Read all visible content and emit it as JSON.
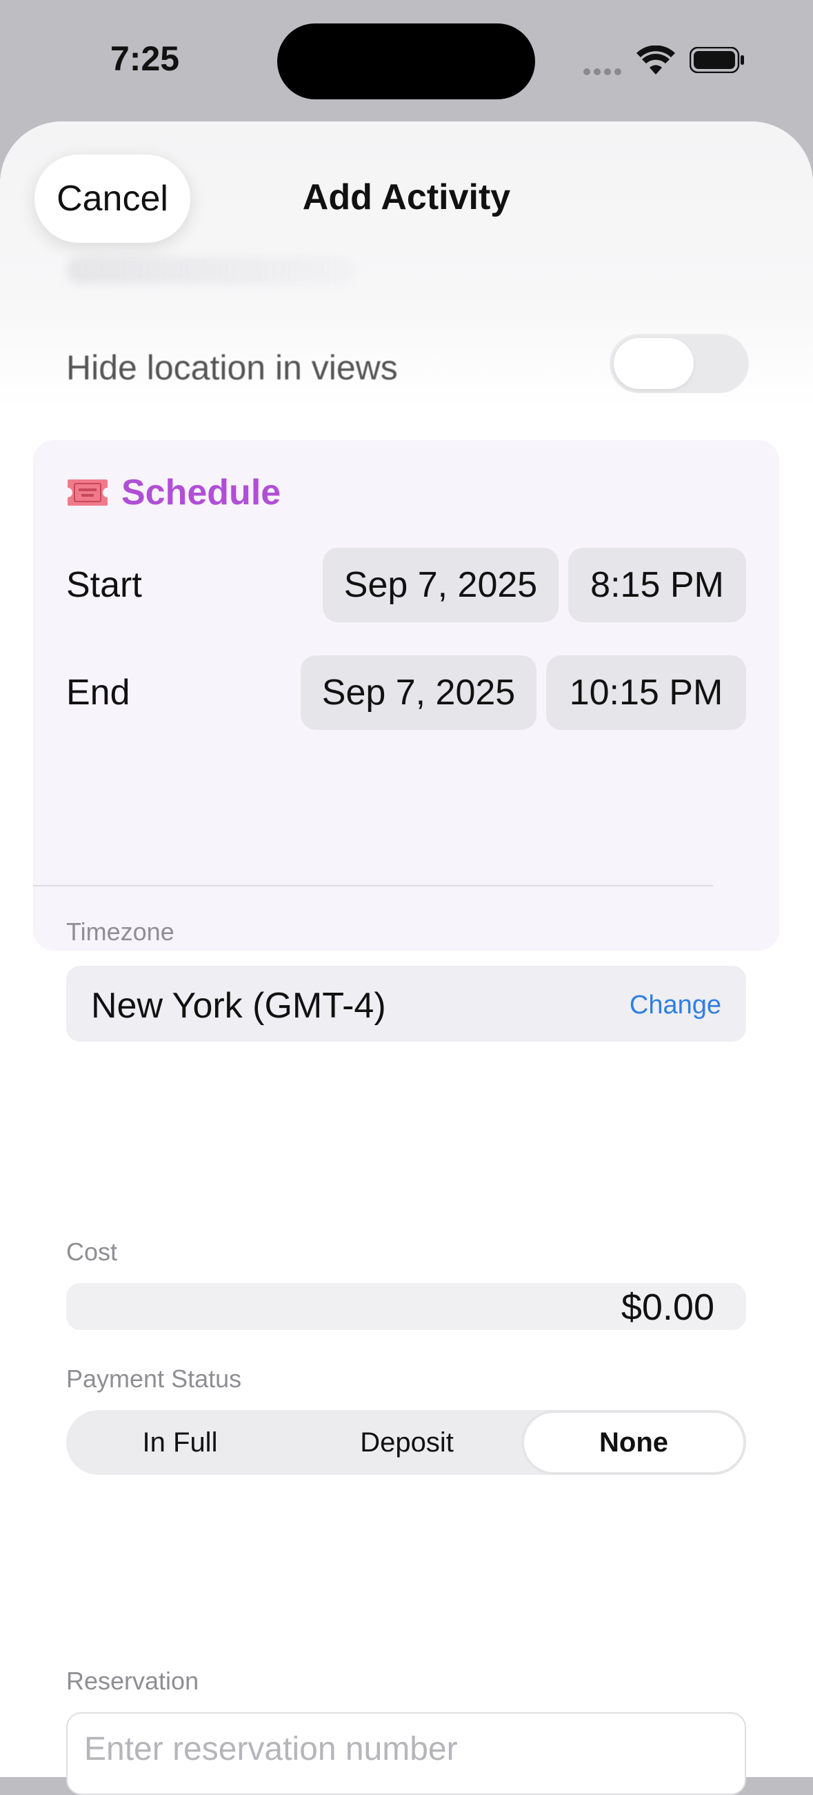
{
  "status_bar": {
    "time": "7:25"
  },
  "sheet": {
    "cancel_label": "Cancel",
    "title": "Add Activity"
  },
  "hide_location": {
    "label": "Hide location in views",
    "enabled": false
  },
  "schedule": {
    "title": "Schedule",
    "icon": "ticket-icon",
    "start": {
      "label": "Start",
      "date": "Sep 7, 2025",
      "time": "8:15 PM"
    },
    "end": {
      "label": "End",
      "date": "Sep 7, 2025",
      "time": "10:15 PM"
    },
    "timezone_label": "Timezone",
    "timezone_value": "New York (GMT-4)",
    "timezone_action": "Change",
    "accent_color": "#b04fd6"
  },
  "cost": {
    "label": "Cost",
    "value": "$0.00"
  },
  "payment_status": {
    "label": "Payment Status",
    "options": [
      "In Full",
      "Deposit",
      "None"
    ],
    "selected": "None"
  },
  "reservation": {
    "label": "Reservation",
    "placeholder": "Enter reservation number"
  },
  "colors": {
    "link": "#2f7fe3",
    "card_bg": "#f8f4fb"
  }
}
